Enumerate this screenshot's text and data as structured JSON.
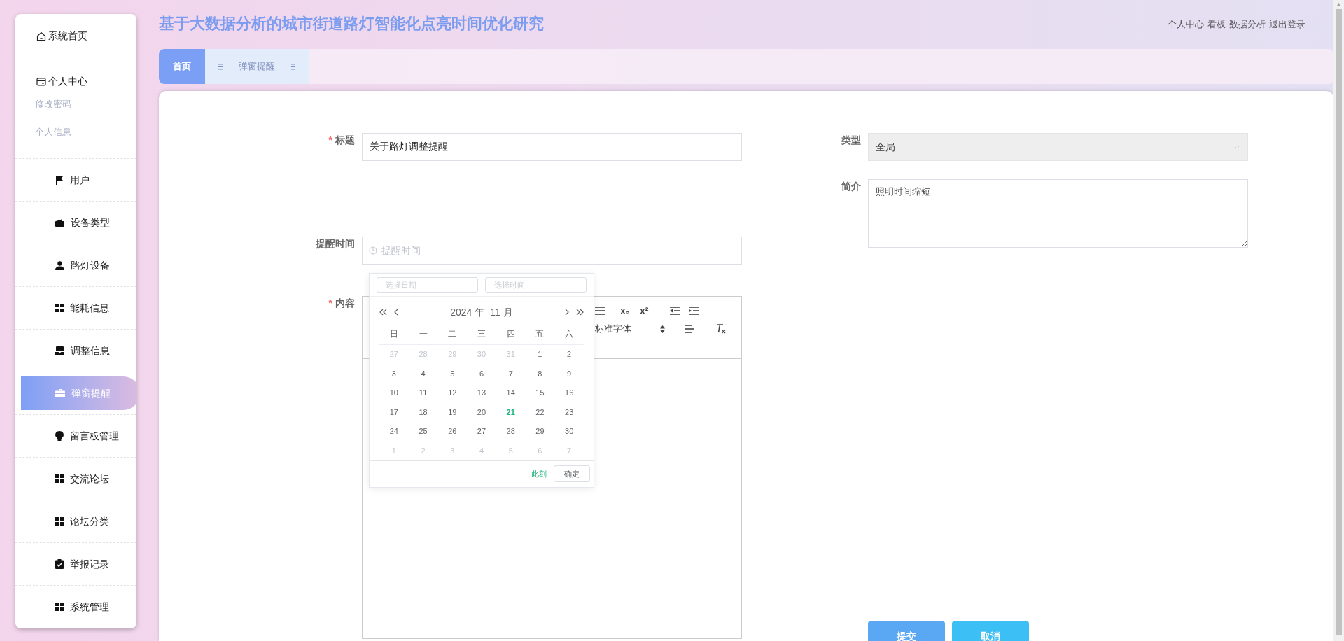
{
  "header": {
    "title": "基于大数据分析的城市街道路灯智能化点亮时间优化研究",
    "links": [
      "个人中心",
      "看板",
      "数据分析",
      "退出登录"
    ]
  },
  "sidebar": {
    "items": [
      {
        "label": "系统首页",
        "selected": false
      },
      {
        "label": "个人中心",
        "selected": false,
        "children": [
          {
            "label": "修改密码"
          },
          {
            "label": "个人信息"
          }
        ]
      },
      {
        "label": "用户",
        "selected": false
      },
      {
        "label": "设备类型",
        "selected": false
      },
      {
        "label": "路灯设备",
        "selected": false
      },
      {
        "label": "能耗信息",
        "selected": false
      },
      {
        "label": "调整信息",
        "selected": false
      },
      {
        "label": "弹窗提醒",
        "selected": true
      },
      {
        "label": "留言板管理",
        "selected": false
      },
      {
        "label": "交流论坛",
        "selected": false
      },
      {
        "label": "论坛分类",
        "selected": false
      },
      {
        "label": "举报记录",
        "selected": false
      },
      {
        "label": "系统管理",
        "selected": false
      }
    ]
  },
  "tabs": [
    {
      "label": "首页",
      "selected": true
    },
    {
      "label": "弹窗提醒",
      "selected": false
    }
  ],
  "form": {
    "required_mark": "*",
    "title": {
      "label": "标题",
      "required": true,
      "value": "关于路灯调整提醒"
    },
    "remind_time": {
      "label": "提醒时间",
      "required": false,
      "placeholder": "提醒时间"
    },
    "content": {
      "label": "内容",
      "required": true
    },
    "type": {
      "label": "类型",
      "required": false,
      "value": "全局"
    },
    "summary": {
      "label": "简介",
      "required": false,
      "value": "照明时间缩短"
    }
  },
  "editor": {
    "tools": [
      "x₂",
      "x²"
    ],
    "font_select": "标准字体"
  },
  "date_picker": {
    "date_placeholder": "选择日期",
    "time_placeholder": "选择时间",
    "year": "2024 年",
    "month": "11 月",
    "weekdays": [
      "日",
      "一",
      "二",
      "三",
      "四",
      "五",
      "六"
    ],
    "days": [
      {
        "label": "27",
        "muted": true,
        "today": false
      },
      {
        "label": "28",
        "muted": true,
        "today": false
      },
      {
        "label": "29",
        "muted": true,
        "today": false
      },
      {
        "label": "30",
        "muted": true,
        "today": false
      },
      {
        "label": "31",
        "muted": true,
        "today": false
      },
      {
        "label": "1",
        "muted": false,
        "today": false
      },
      {
        "label": "2",
        "muted": false,
        "today": false
      },
      {
        "label": "3",
        "muted": false,
        "today": false
      },
      {
        "label": "4",
        "muted": false,
        "today": false
      },
      {
        "label": "5",
        "muted": false,
        "today": false
      },
      {
        "label": "6",
        "muted": false,
        "today": false
      },
      {
        "label": "7",
        "muted": false,
        "today": false
      },
      {
        "label": "8",
        "muted": false,
        "today": false
      },
      {
        "label": "9",
        "muted": false,
        "today": false
      },
      {
        "label": "10",
        "muted": false,
        "today": false
      },
      {
        "label": "11",
        "muted": false,
        "today": false
      },
      {
        "label": "12",
        "muted": false,
        "today": false
      },
      {
        "label": "13",
        "muted": false,
        "today": false
      },
      {
        "label": "14",
        "muted": false,
        "today": false
      },
      {
        "label": "15",
        "muted": false,
        "today": false
      },
      {
        "label": "16",
        "muted": false,
        "today": false
      },
      {
        "label": "17",
        "muted": false,
        "today": false
      },
      {
        "label": "18",
        "muted": false,
        "today": false
      },
      {
        "label": "19",
        "muted": false,
        "today": false
      },
      {
        "label": "20",
        "muted": false,
        "today": false
      },
      {
        "label": "21",
        "muted": false,
        "today": true
      },
      {
        "label": "22",
        "muted": false,
        "today": false
      },
      {
        "label": "23",
        "muted": false,
        "today": false
      },
      {
        "label": "24",
        "muted": false,
        "today": false
      },
      {
        "label": "25",
        "muted": false,
        "today": false
      },
      {
        "label": "26",
        "muted": false,
        "today": false
      },
      {
        "label": "27",
        "muted": false,
        "today": false
      },
      {
        "label": "28",
        "muted": false,
        "today": false
      },
      {
        "label": "29",
        "muted": false,
        "today": false
      },
      {
        "label": "30",
        "muted": false,
        "today": false
      },
      {
        "label": "1",
        "muted": true,
        "today": false
      },
      {
        "label": "2",
        "muted": true,
        "today": false
      },
      {
        "label": "3",
        "muted": true,
        "today": false
      },
      {
        "label": "4",
        "muted": true,
        "today": false
      },
      {
        "label": "5",
        "muted": true,
        "today": false
      },
      {
        "label": "6",
        "muted": true,
        "today": false
      },
      {
        "label": "7",
        "muted": true,
        "today": false
      }
    ],
    "now_link": "此刻",
    "confirm": "确定"
  },
  "buttons": [
    {
      "label": "提交",
      "kind": "submit"
    },
    {
      "label": "取消",
      "kind": "cancel"
    }
  ]
}
